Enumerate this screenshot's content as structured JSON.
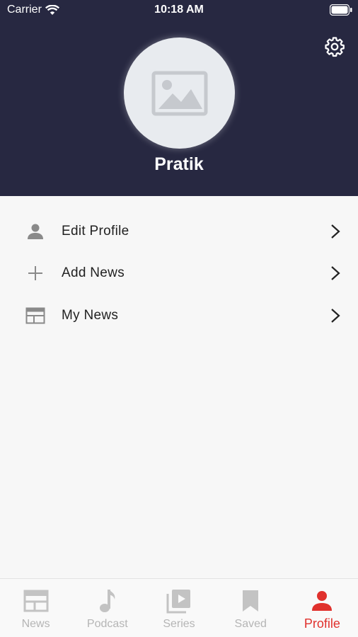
{
  "status_bar": {
    "carrier": "Carrier",
    "time": "10:18 AM"
  },
  "profile": {
    "name": "Pratik"
  },
  "menu": [
    {
      "label": "Edit Profile",
      "icon": "person-icon"
    },
    {
      "label": "Add News",
      "icon": "plus-icon"
    },
    {
      "label": "My News",
      "icon": "news-icon"
    }
  ],
  "tabs": [
    {
      "label": "News",
      "icon": "newspaper-icon"
    },
    {
      "label": "Podcast",
      "icon": "music-note-icon"
    },
    {
      "label": "Series",
      "icon": "video-stack-icon"
    },
    {
      "label": "Saved",
      "icon": "bookmark-icon"
    },
    {
      "label": "Profile",
      "icon": "person-icon",
      "active": true
    }
  ],
  "colors": {
    "header": "#272841",
    "accent": "#e0312d",
    "inactive": "#b5b5b5"
  }
}
